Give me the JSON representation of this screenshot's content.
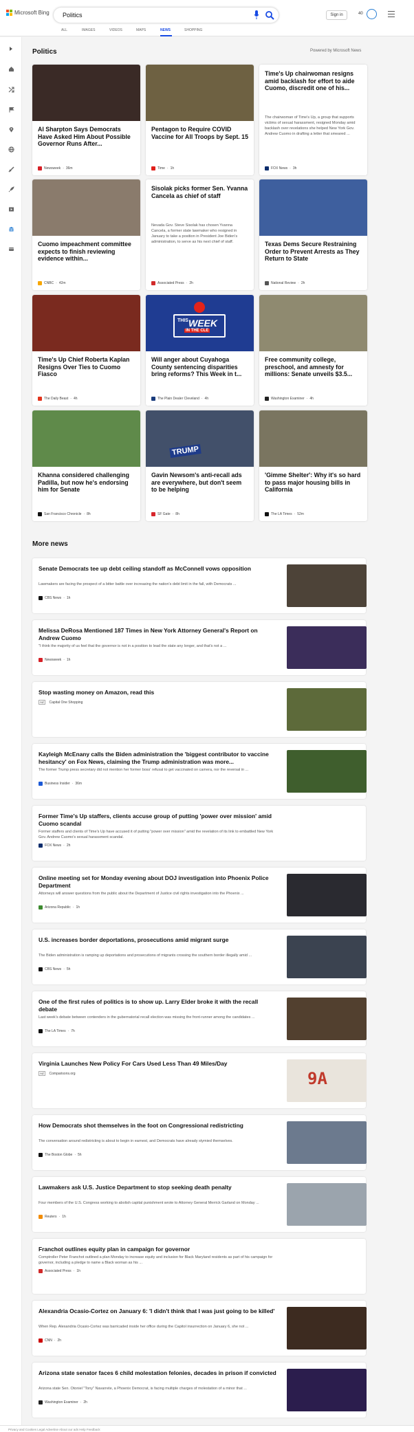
{
  "header": {
    "brand": "Microsoft Bing",
    "search_value": "Politics",
    "signin_label": "Sign in",
    "rewards_count": "40",
    "icons": [
      "microsoft-logo",
      "mic-icon",
      "search-icon",
      "rewards-icon",
      "hamburger-menu-icon"
    ]
  },
  "tabs": [
    {
      "label": "ALL",
      "active": false
    },
    {
      "label": "IMAGES",
      "active": false
    },
    {
      "label": "VIDEOS",
      "active": false
    },
    {
      "label": "MAPS",
      "active": false
    },
    {
      "label": "NEWS",
      "active": true
    },
    {
      "label": "SHOPPING",
      "active": false
    }
  ],
  "rail_icons": [
    "expand-icon",
    "home-icon",
    "crossover-icon",
    "flag-icon",
    "location-icon",
    "globe-icon",
    "science-icon",
    "rocket-icon",
    "entertainment-icon",
    "building-icon",
    "money-icon"
  ],
  "politics": {
    "title": "Politics",
    "powered_by": "Powered by Microsoft News",
    "cards": [
      {
        "title": "Al Sharpton Says Democrats Have Asked Him About Possible Governor Runs After...",
        "source": "Newsweek",
        "time": "36m",
        "source_color": "#d62027",
        "image_color": "#3a2a26"
      },
      {
        "title": "Pentagon to Require COVID Vaccine for All Troops by Sept. 15",
        "source": "Time",
        "time": "1h",
        "source_color": "#e0201b",
        "image_color": "#6e6142"
      },
      {
        "title": "Time's Up chairwoman resigns amid backlash for effort to aide Cuomo, discredit one of his...",
        "summary": "The chairwoman of Time's Up, a group that supports victims of sexual harassment, resigned Monday amid backlash over revelations she helped New York Gov. Andrew Cuomo in drafting a letter that smeared ...",
        "source": "FOX News",
        "time": "3h",
        "source_color": "#0d2d6c"
      },
      {
        "title": "Cuomo impeachment committee expects to finish reviewing evidence within...",
        "source": "CNBC",
        "time": "42m",
        "source_color": "#f7a600",
        "image_color": "#8a7b6c"
      },
      {
        "title": "Sisolak picks former Sen. Yvanna Cancela as chief of staff",
        "summary": "Nevada Gov. Steve Sisolak has chosen Yvanna Cancela, a former state lawmaker who resigned in January to take a position in President Joe Biden's administration, to serve as his next chief of staff.",
        "source": "Associated Press",
        "time": "2h",
        "source_color": "#d12a2a"
      },
      {
        "title": "Texas Dems Secure Restraining Order to Prevent Arrests as They Return to State",
        "source": "National Review",
        "time": "2h",
        "source_color": "#555555",
        "image_color": "#3e5f9e"
      },
      {
        "title": "Time's Up Chief Roberta Kaplan Resigns Over Ties to Cuomo Fiasco",
        "source": "The Daily Beast",
        "time": "4h",
        "source_color": "#e2341d",
        "image_color": "#7a2a1f"
      },
      {
        "title": "Will anger about Cuyahoga County sentencing disparities bring reforms? This Week in t...",
        "source": "The Plain Dealer Cleveland",
        "time": "4h",
        "source_color": "#1a3c7c",
        "image_color": "#1f3c92",
        "image_text_1": "THIS",
        "image_text_2": "WEEK",
        "image_text_3": "IN THE CLE"
      },
      {
        "title": "Free community college, preschool, and amnesty for millions: Senate unveils $3.5...",
        "source": "Washington Examiner",
        "time": "4h",
        "source_color": "#222222",
        "image_color": "#8f8a70"
      },
      {
        "title": "Khanna considered challenging Padilla, but now he's endorsing him for Senate",
        "source": "San Francisco Chronicle",
        "time": "8h",
        "source_color": "#111111",
        "image_color": "#5f8a4a"
      },
      {
        "title": "Gavin Newsom's anti-recall ads are everywhere, but don't seem to be helping",
        "source": "SF Gate",
        "time": "8h",
        "source_color": "#d7262c",
        "image_color": "#42506a",
        "image_text_1": "TRUMP"
      },
      {
        "title": "'Gimme Shelter': Why it's so hard to pass major housing bills in California",
        "source": "The LA Times",
        "time": "52m",
        "source_color": "#111111",
        "image_color": "#7a7560"
      }
    ]
  },
  "more_news": {
    "title": "More news",
    "items": [
      {
        "title": "Senate Democrats tee up debt ceiling standoff as McConnell vows opposition",
        "summary": "Lawmakers are facing the prospect of a bitter battle over increasing the nation's debt limit in the fall, with Democrats ...",
        "source": "CBS News",
        "time": "1h",
        "ad": false,
        "source_color": "#111111",
        "image_color": "#4d4338"
      },
      {
        "title": "Melissa DeRosa Mentioned 187 Times in New York Attorney General's Report on Andrew Cuomo",
        "summary": "\"I think the majority of us feel that the governor is not in a position to lead the state any longer, and that's not a ...",
        "source": "Newsweek",
        "time": "1h",
        "ad": false,
        "source_color": "#d62027",
        "image_color": "#3b2d5a"
      },
      {
        "title": "Stop wasting money on Amazon, read this",
        "summary": "",
        "source": "Capital One Shopping",
        "time": "",
        "ad": true,
        "ad_label": "Ad",
        "source_color": "#ffffff",
        "image_color": "#5d6a3a"
      },
      {
        "title": "Kayleigh McEnany calls the Biden administration the 'biggest contributor to vaccine hesitancy' on Fox News, claiming the Trump administration was more...",
        "summary": "The former Trump press secretary did not mention her former boss' refusal to get vaccinated on camera, nor the reversal in ...",
        "source": "Business Insider",
        "time": "36m",
        "ad": false,
        "source_color": "#1c5ad6",
        "image_color": "#3f5e2d"
      },
      {
        "title": "Former Time's Up staffers, clients accuse group of putting 'power over mission' amid Cuomo scandal",
        "summary": "Former staffers and clients of Time's Up have accused it of putting \"power over mission\" amid the revelation of its link to embattled New York Gov. Andrew Cuomo's sexual harassment scandal.",
        "source": "FOX News",
        "time": "2h",
        "ad": false,
        "source_color": "#0d2d6c",
        "no_image": true
      },
      {
        "title": "Online meeting set for Monday evening about DOJ investigation into Phoenix Police Department",
        "summary": "Attorneys will answer questions from the public about the Department of Justice civil rights investigation into the Phoenix ...",
        "source": "Arizona Republic",
        "time": "1h",
        "ad": false,
        "source_color": "#3c8a2e",
        "image_color": "#2a2a30"
      },
      {
        "title": "U.S. increases border deportations, prosecutions amid migrant surge",
        "summary": "The Biden administration is ramping up deportations and prosecutions of migrants crossing the southern border illegally amid ...",
        "source": "CBS News",
        "time": "5h",
        "ad": false,
        "source_color": "#111111",
        "image_color": "#3b4350"
      },
      {
        "title": "One of the first rules of politics is to show up. Larry Elder broke it with the recall debate",
        "summary": "Last week's debate between contenders in the gubernatorial recall election was missing the front-runner among the candidates ...",
        "source": "The LA Times",
        "time": "7h",
        "ad": false,
        "source_color": "#111111",
        "image_color": "#52402f"
      },
      {
        "title": "Virginia Launches New Policy For Cars Used Less Than 49 Miles/Day",
        "summary": "",
        "source": "Comparisons.org",
        "time": "",
        "ad": true,
        "ad_label": "Ad",
        "source_color": "#ffffff",
        "image_color": "#e9e4dc",
        "image_text_1": "9A"
      },
      {
        "title": "How Democrats shot themselves in the foot on Congressional redistricting",
        "summary": "The conversation around redistricting is about to begin in earnest, and Democrats have already stymied themselves.",
        "source": "The Boston Globe",
        "time": "5h",
        "ad": false,
        "source_color": "#111111",
        "image_color": "#6c7a8e"
      },
      {
        "title": "Lawmakers ask U.S. Justice Department to stop seeking death penalty",
        "summary": "Four members of the U.S. Congress working to abolish capital punishment wrote to Attorney General Merrick Garland on Monday ...",
        "source": "Reuters",
        "time": "1h",
        "ad": false,
        "source_color": "#f28c00",
        "image_color": "#9ba4ad"
      },
      {
        "title": "Franchot outlines equity plan in campaign for governor",
        "summary": "Comptroller Peter Franchot outlined a plan Monday to increase equity and inclusion for Black Maryland residents as part of his campaign for governor, including a pledge to name a Black woman as his ...",
        "source": "Associated Press",
        "time": "1h",
        "ad": false,
        "source_color": "#d12a2a",
        "no_image": true
      },
      {
        "title": "Alexandria Ocasio-Cortez on January 6: 'I didn't think that I was just going to be killed'",
        "summary": "When Rep. Alexandria Ocasio-Cortez was barricaded inside her office during the Capitol insurrection on January 6, she not ...",
        "source": "CNN",
        "time": "2h",
        "ad": false,
        "source_color": "#cc0000",
        "image_color": "#3d2b20"
      },
      {
        "title": "Arizona state senator faces 6 child molestation felonies, decades in prison if convicted",
        "summary": "Arizona state Sen. Otoniel \"Tony\" Navarrete, a Phoenix Democrat, is facing multiple charges of molestation of a minor that ...",
        "source": "Washington Examiner",
        "time": "2h",
        "ad": false,
        "source_color": "#222222",
        "image_color": "#2b1d4d"
      }
    ]
  },
  "footer": {
    "text": "Privacy and Cookies   Legal   Advertise   About our ads   Help   Feedback"
  }
}
